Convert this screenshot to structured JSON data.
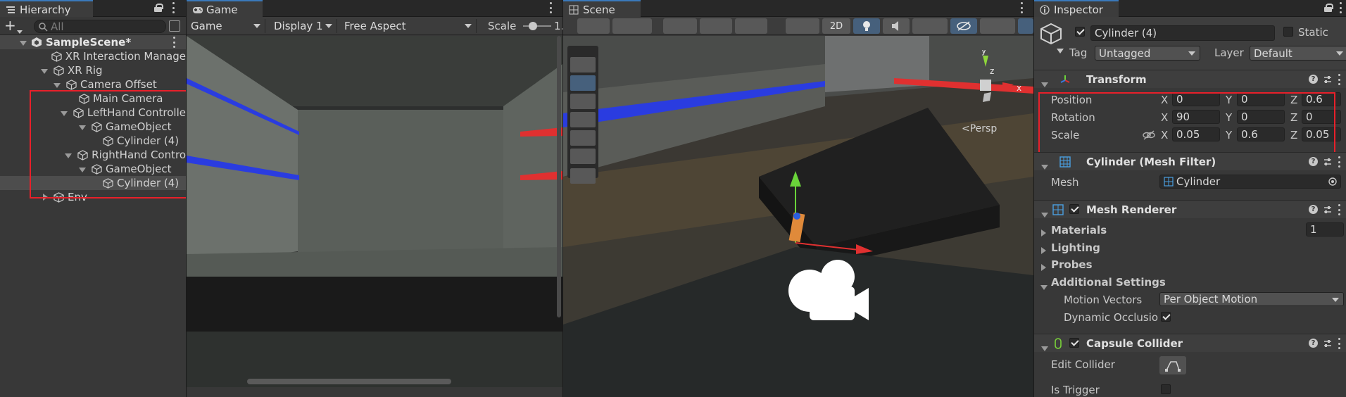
{
  "hierarchy": {
    "tab_label": "Hierarchy",
    "search_placeholder": "All",
    "add_label": "+",
    "scene_name": "SampleScene*",
    "items": [
      {
        "label": "XR Interaction Manage"
      },
      {
        "label": "XR Rig"
      },
      {
        "label": "Camera Offset"
      },
      {
        "label": "Main Camera"
      },
      {
        "label": "LeftHand Controlle"
      },
      {
        "label": "GameObject"
      },
      {
        "label": "Cylinder (4)"
      },
      {
        "label": "RightHand Contro"
      },
      {
        "label": "GameObject"
      },
      {
        "label": "Cylinder (4)"
      },
      {
        "label": "Env"
      }
    ]
  },
  "game": {
    "tab_label": "Game",
    "mode_dropdown": "Game",
    "display_dropdown": "Display 1",
    "aspect_dropdown": "Free Aspect",
    "scale_label": "Scale",
    "scale_value": "1."
  },
  "scene": {
    "tab_label": "Scene",
    "btn_2d": "2D",
    "persp_label": "Persp",
    "gizmo_axes": {
      "y": "y",
      "z": "z",
      "x": "x"
    }
  },
  "inspector": {
    "tab_label": "Inspector",
    "object_name": "Cylinder (4)",
    "static_label": "Static",
    "tag_label": "Tag",
    "tag_value": "Untagged",
    "layer_label": "Layer",
    "layer_value": "Default",
    "transform": {
      "title": "Transform",
      "position_label": "Position",
      "rotation_label": "Rotation",
      "scale_label": "Scale",
      "axis_x": "X",
      "axis_y": "Y",
      "axis_z": "Z",
      "position": {
        "x": "0",
        "y": "0",
        "z": "0.6"
      },
      "rotation": {
        "x": "90",
        "y": "0",
        "z": "0"
      },
      "scale": {
        "x": "0.05",
        "y": "0.6",
        "z": "0.05"
      }
    },
    "mesh_filter": {
      "title": "Cylinder (Mesh Filter)",
      "mesh_label": "Mesh",
      "mesh_value": "Cylinder"
    },
    "mesh_renderer": {
      "title": "Mesh Renderer",
      "materials_label": "Materials",
      "materials_count": "1",
      "lighting_label": "Lighting",
      "probes_label": "Probes",
      "additional_label": "Additional Settings",
      "motion_vectors_label": "Motion Vectors",
      "motion_vectors_value": "Per Object Motion",
      "dynamic_occlusion_label": "Dynamic Occlusio"
    },
    "capsule_collider": {
      "title": "Capsule Collider",
      "edit_collider_label": "Edit Collider",
      "is_trigger_label": "Is Trigger"
    }
  },
  "colors": {
    "accent": "#3a79bb",
    "highlight": "#e8202a",
    "selected_row": "#4d4d4d"
  }
}
